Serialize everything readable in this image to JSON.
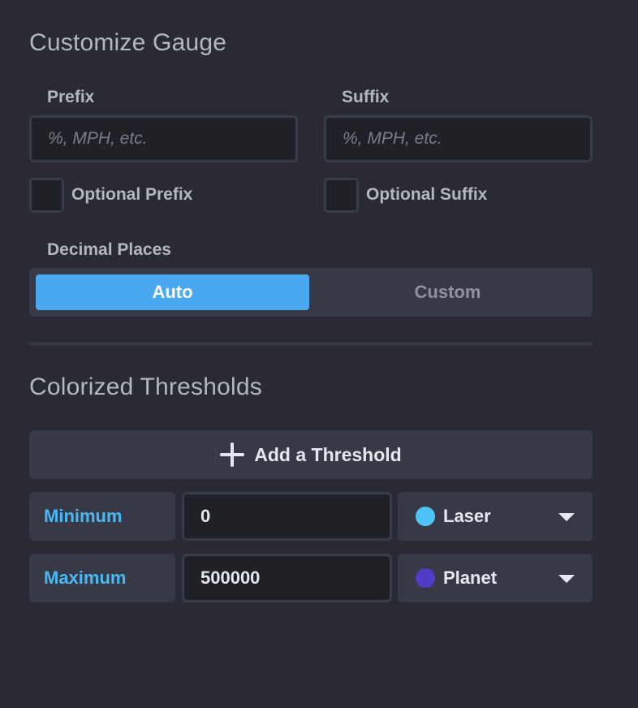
{
  "customize": {
    "title": "Customize Gauge",
    "prefix": {
      "label": "Prefix",
      "placeholder": "%, MPH, etc.",
      "value": ""
    },
    "suffix": {
      "label": "Suffix",
      "placeholder": "%, MPH, etc.",
      "value": ""
    },
    "optional_prefix": {
      "label": "Optional Prefix",
      "checked": false
    },
    "optional_suffix": {
      "label": "Optional Suffix",
      "checked": false
    },
    "decimal_places": {
      "label": "Decimal Places",
      "options": [
        "Auto",
        "Custom"
      ],
      "selected": "Auto"
    }
  },
  "thresholds": {
    "title": "Colorized Thresholds",
    "add_label": "Add a Threshold",
    "rows": [
      {
        "label": "Minimum",
        "value": "0",
        "color_name": "Laser",
        "color": "#4ec3f7"
      },
      {
        "label": "Maximum",
        "value": "500000",
        "color_name": "Planet",
        "color": "#513cc6"
      }
    ]
  },
  "colors": {
    "background": "#292a33",
    "accent": "#4aa8f0",
    "label_accent": "#4ab8f5"
  }
}
